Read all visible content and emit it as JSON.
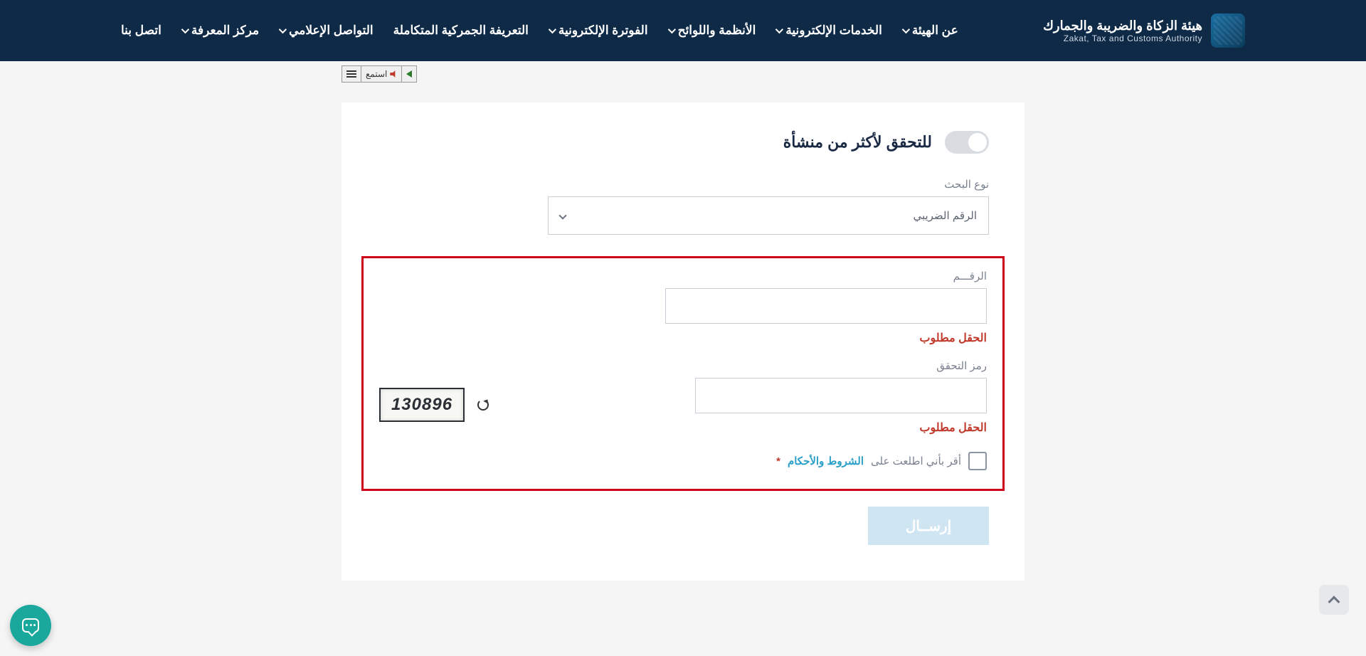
{
  "brand": {
    "ar": "هيئة الزكاة والضريبة والجمارك",
    "en": "Zakat, Tax and Customs Authority"
  },
  "nav": {
    "about": "عن الهيئة",
    "eservices": "الخدمات الإلكترونية",
    "regulations": "الأنظمة واللوائح",
    "einvoice": "الفوترة الإلكترونية",
    "customs_tariff": "التعريفة الجمركية المتكاملة",
    "media": "التواصل الإعلامي",
    "knowledge": "مركز المعرفة",
    "contact": "اتصل بنا"
  },
  "listen": {
    "label": "استمع"
  },
  "form": {
    "multi_toggle_label": "للتحقق لأكثر من منشأة",
    "search_type_label": "نوع البحث",
    "search_type_value": "الرقم الضريبي",
    "number_label": "الرقـــم",
    "required_msg": "الحقل مطلوب",
    "captcha_label": "رمز التحقق",
    "captcha_value": "130896",
    "ack_prefix": "أقر بأني اطلعت على",
    "ack_link": "الشروط والأحكام",
    "asterisk": "*",
    "submit": "إرســال"
  }
}
